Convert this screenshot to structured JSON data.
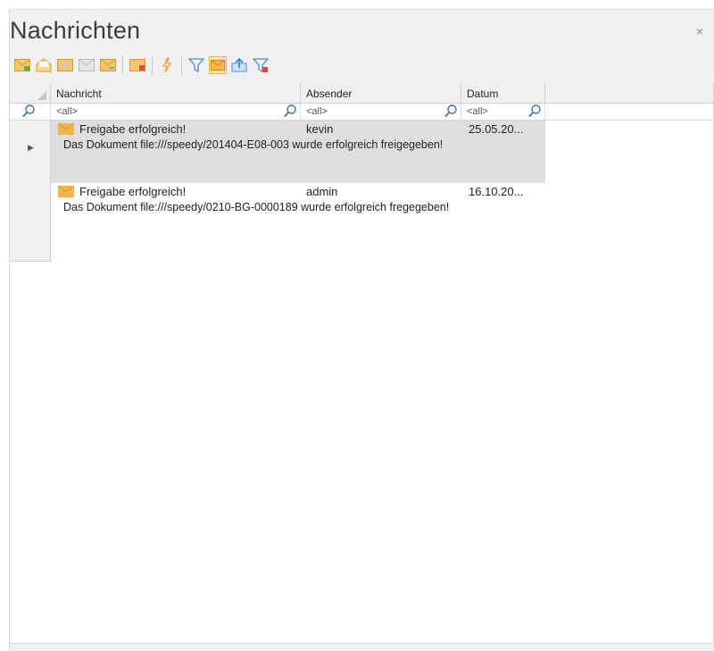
{
  "window": {
    "title": "Nachrichten",
    "close_glyph": "×"
  },
  "toolbar": {
    "buttons": [
      {
        "icon": "new-message-icon"
      },
      {
        "icon": "open-envelope-icon"
      },
      {
        "icon": "message-list-icon"
      },
      {
        "icon": "reply-icon"
      },
      {
        "icon": "forward-message-icon"
      },
      {
        "icon": "delete-message-icon"
      },
      {
        "icon": "lightning-icon"
      },
      {
        "icon": "filter-icon"
      },
      {
        "icon": "envelope-active-icon"
      },
      {
        "icon": "export-icon"
      },
      {
        "icon": "clear-filter-icon"
      }
    ]
  },
  "grid": {
    "columns": [
      "Nachricht",
      "Absender",
      "Datum"
    ],
    "filters": [
      "<all>",
      "<all>",
      "<all>"
    ],
    "rows": [
      {
        "subject": "Freigabe erfolgreich!",
        "sender": "kevin",
        "date": "25.05.20...",
        "body": "Das Dokument file:///speedy/201404-E08-003 wurde erfolgreich freigegeben!",
        "selected": true
      },
      {
        "subject": "Freigabe erfolgreich!",
        "sender": "admin",
        "date": "16.10.20...",
        "body": "Das Dokument file:///speedy/0210-BG-0000189 wurde erfolgreich fregegeben!",
        "selected": false
      }
    ]
  },
  "colors": {
    "envelope": "#f2b64a",
    "selected_row": "#dedede",
    "toolbar_active": "#fbe3a3"
  }
}
